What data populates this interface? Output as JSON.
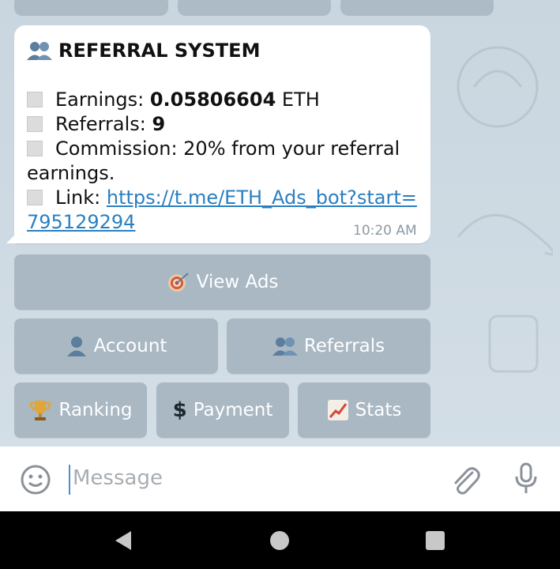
{
  "message": {
    "title": "REFERRAL SYSTEM",
    "earnings_label": "Earnings: ",
    "earnings_value": "0.05806604",
    "earnings_unit": " ETH",
    "referrals_label": "Referrals: ",
    "referrals_value": "9",
    "commission_line1": "Commission: 20% from your referral",
    "commission_line2": "earnings.",
    "link_label": "Link: ",
    "link_part1": "https://t.me/ETH_Ads_bot?start=",
    "link_part2": "795129294",
    "time": "10:20 AM"
  },
  "keyboard": {
    "view_ads": "View Ads",
    "account": "Account",
    "referrals": "Referrals",
    "ranking": "Ranking",
    "payment": "Payment",
    "stats": "Stats"
  },
  "input": {
    "placeholder": "Message"
  },
  "colors": {
    "chat_background": "#cfdbe3",
    "keyboard_button": "#a9b8c3",
    "link": "#2a7fc0",
    "timestamp": "#8b9aa4"
  },
  "icons": [
    "users-icon",
    "square-bullet-icon",
    "target-icon",
    "user-icon",
    "trophy-icon",
    "dollar-icon",
    "chart-up-icon",
    "smile-icon",
    "paperclip-icon",
    "microphone-icon",
    "back-icon",
    "home-icon",
    "recents-icon"
  ]
}
